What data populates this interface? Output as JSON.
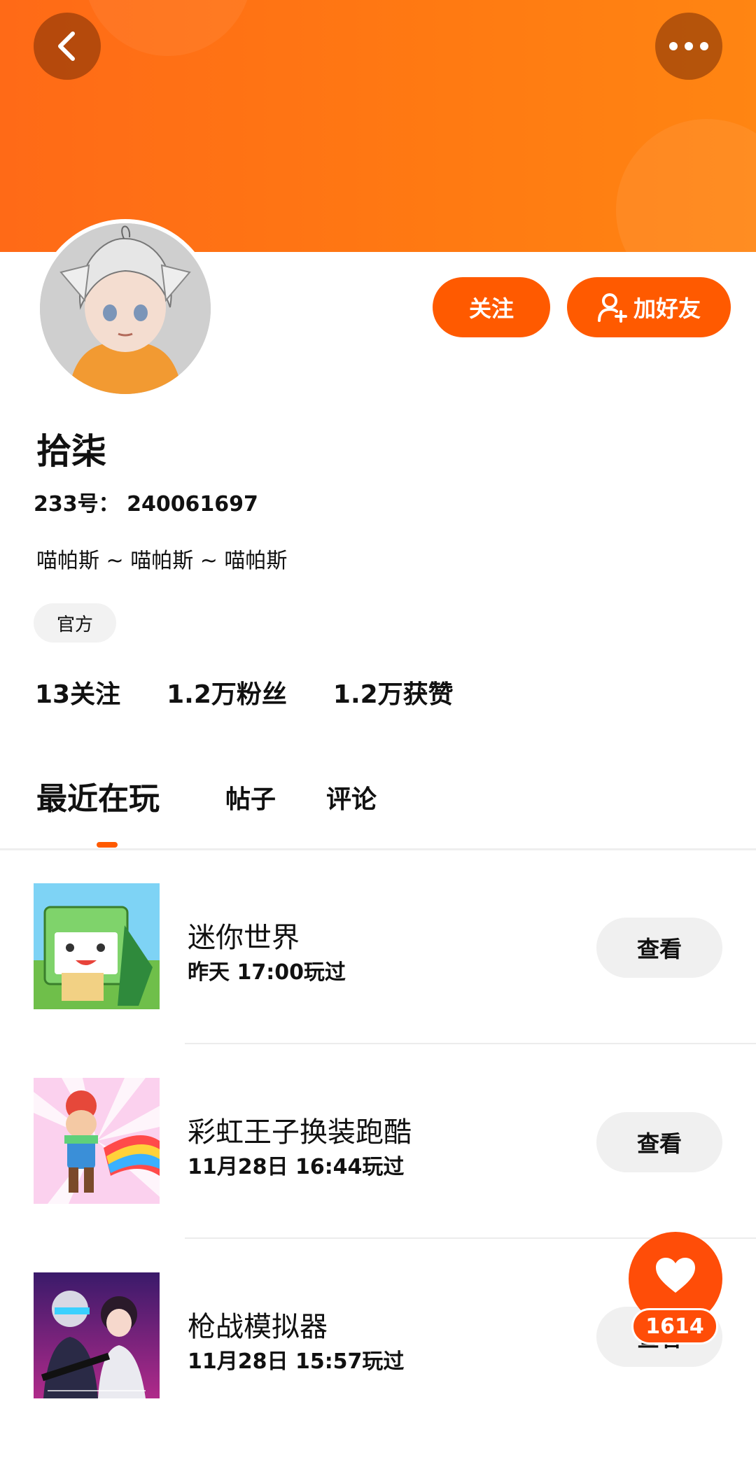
{
  "header": {
    "back_icon": "chevron-left-icon",
    "more_icon": "more-horizontal-icon",
    "accent_color": "#ff6a17"
  },
  "profile": {
    "name": "拾柒",
    "uid": "233号： 240061697",
    "bio": "喵帕斯 ~ 喵帕斯 ~ 喵帕斯",
    "badge": "官方",
    "follow_label": "关注",
    "add_friend_label": "加好友",
    "stats": {
      "following": "13关注",
      "fans": "1.2万粉丝",
      "likes": "1.2万获赞"
    }
  },
  "tabs": [
    "最近在玩",
    "帖子",
    "评论"
  ],
  "games": [
    {
      "title": "迷你世界",
      "time": "昨天 17:00玩过",
      "button": "查看"
    },
    {
      "title": "彩虹王子换装跑酷",
      "time": "11月28日 16:44玩过",
      "button": "查看"
    },
    {
      "title": "枪战模拟器",
      "time": "11月28日 15:57玩过",
      "button": "查看"
    }
  ],
  "like_fab": {
    "icon": "heart-icon",
    "count": "1614",
    "color": "#ff4d08"
  }
}
